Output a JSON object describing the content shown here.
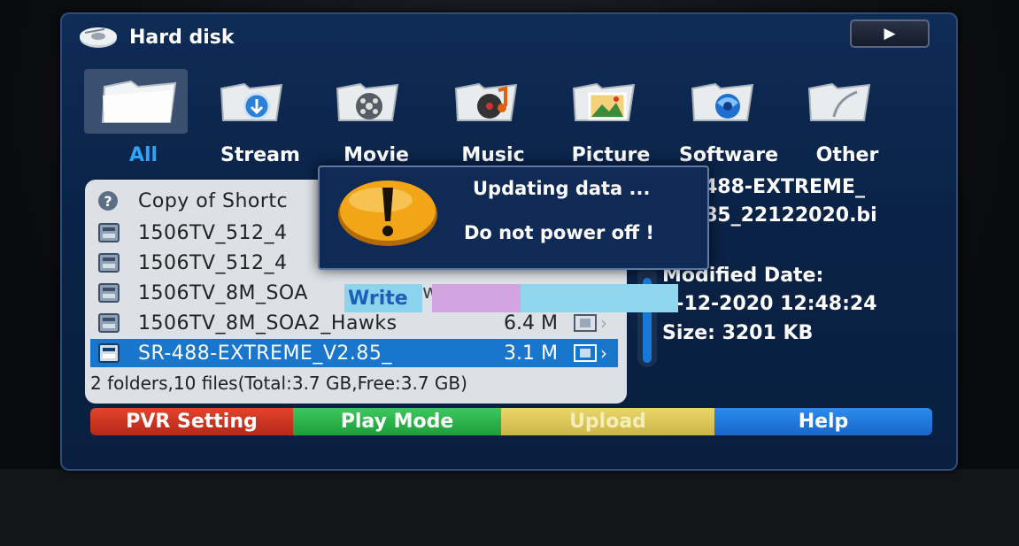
{
  "header": {
    "title": "Hard disk",
    "play_symbol": "▶"
  },
  "categories": [
    {
      "label": "All",
      "active": true
    },
    {
      "label": "Stream"
    },
    {
      "label": "Movie"
    },
    {
      "label": "Music"
    },
    {
      "label": "Picture"
    },
    {
      "label": "Software"
    },
    {
      "label": "Other"
    }
  ],
  "files": [
    {
      "name": "Copy of Shortc",
      "size": "",
      "kind": "help-shortcut"
    },
    {
      "name": "1506TV_512_4",
      "size": "",
      "kind": "file"
    },
    {
      "name": "1506TV_512_4",
      "size": "",
      "kind": "file"
    },
    {
      "name": "1506TV_8M_SOA",
      "size": "",
      "kind": "file"
    },
    {
      "name": "1506TV_8M_SOA2_Hawks",
      "size": "6.4 M",
      "kind": "file"
    },
    {
      "name": "SR-488-EXTREME_V2.85_",
      "size": "3.1 M",
      "kind": "file",
      "selected": true
    }
  ],
  "summary": "2 folders,10 files(Total:3.7 GB,Free:3.7 GB)",
  "info": {
    "name_line1": "488-EXTREME_",
    "name_line2": "85_22122020.bi",
    "modified_label": "Modified Date:",
    "modified_value": "2-12-2020 12:48:24",
    "size": "Size: 3201 KB"
  },
  "dialog": {
    "line1": "Updating data ...",
    "line2": "Do not power off !"
  },
  "overlay": {
    "write_label": "Write",
    "fragment": "w"
  },
  "footer": {
    "red": "PVR Setting",
    "green": "Play Mode",
    "yellow": "Upload",
    "blue": "Help"
  },
  "colors": {
    "red": "#d0351f",
    "green": "#2ab64d",
    "yellow": "#dcc85a",
    "blue": "#1f7ae0",
    "highlight": "#1876cc"
  }
}
